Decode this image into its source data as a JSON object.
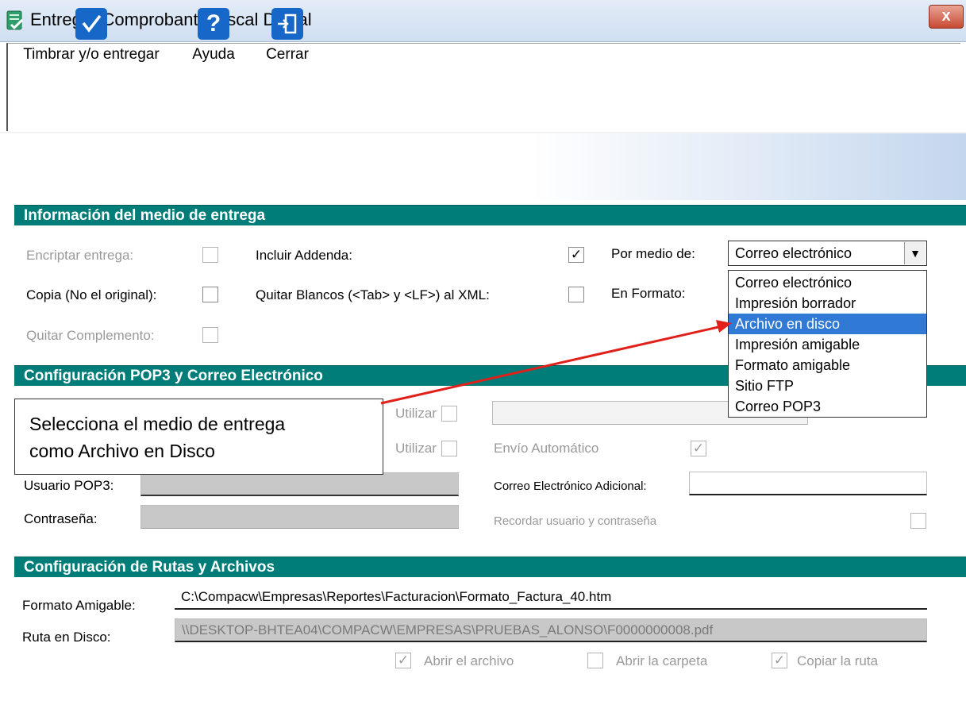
{
  "window": {
    "title": "Entregar Comprobante Fiscal Digital",
    "close_glyph": "x"
  },
  "toolbar": {
    "timbrar_label": "Timbrar y/o entregar",
    "ayuda_label": "Ayuda",
    "cerrar_label": "Cerrar"
  },
  "section_medio": {
    "header": "Información del medio de entrega",
    "encriptar_label": "Encriptar entrega:",
    "copia_label": "Copia (No el original):",
    "quitar_complemento_label": "Quitar Complemento:",
    "incluir_addenda_label": "Incluir Addenda:",
    "quitar_blancos_label": "Quitar Blancos (<Tab> y <LF>) al  XML:",
    "por_medio_label": "Por medio de:",
    "en_formato_label": "En Formato:",
    "por_medio_value": "Correo electrónico",
    "dropdown_options": [
      "Correo electrónico",
      "Impresión borrador",
      "Archivo en disco",
      "Impresión amigable",
      "Formato amigable",
      "Sitio FTP",
      "Correo POP3"
    ],
    "selected_option": "Archivo en disco"
  },
  "section_pop3": {
    "header": "Configuración POP3 y Correo Electrónico",
    "utilizar1_label": "Utilizar",
    "utilizar2_label": "Utilizar",
    "envio_automatico_label": "Envío Automático",
    "usuario_label": "Usuario POP3:",
    "contrasena_label": "Contraseña:",
    "correo_adicional_label": "Correo Electrónico Adicional:",
    "recordar_label": "Recordar usuario y contraseña"
  },
  "section_rutas": {
    "header": "Configuración de Rutas y Archivos",
    "formato_amigable_label": "Formato Amigable:",
    "formato_amigable_value": "C:\\Compacw\\Empresas\\Reportes\\Facturacion\\Formato_Factura_40.htm",
    "ruta_disco_label": "Ruta en Disco:",
    "ruta_disco_value": "\\\\DESKTOP-BHTEA04\\COMPACW\\EMPRESAS\\PRUEBAS_ALONSO\\F0000000008.pdf",
    "abrir_archivo_label": "Abrir el archivo",
    "abrir_carpeta_label": "Abrir la carpeta",
    "copiar_ruta_label": "Copiar la ruta"
  },
  "callout": {
    "line1": "Selecciona el medio de entrega",
    "line2": "como Archivo en Disco"
  },
  "colors": {
    "section_header": "#007d78",
    "selection": "#3079d4",
    "annotation_arrow": "#e0201b"
  }
}
